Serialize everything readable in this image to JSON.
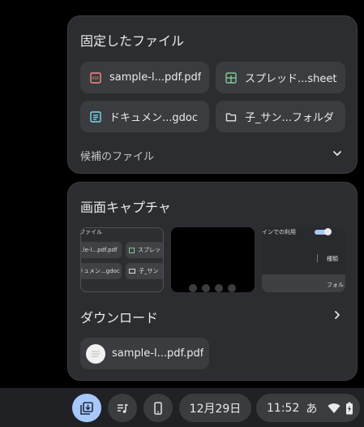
{
  "pinned": {
    "title": "固定したファイル",
    "files": [
      {
        "label": "sample-l...pdf.pdf",
        "icon": "pdf-file-icon",
        "badge": "PDF",
        "color": "#f28b82"
      },
      {
        "label": "スプレッド...sheet",
        "icon": "spreadsheet-icon",
        "color": "#81c995"
      },
      {
        "label": "ドキュメン...gdoc",
        "icon": "document-icon",
        "color": "#78d9ec"
      },
      {
        "label": "子_サン...フォルダ",
        "icon": "folder-icon",
        "color": "#e3e3e3"
      }
    ],
    "suggestions_label": "候補のファイル"
  },
  "holding": {
    "screenshots_title": "画面キャプチャ",
    "thumb1": {
      "header": "ファイル",
      "chip1": "...le-l...pdf.pdf",
      "chip2": "スプレッ",
      "chip3": "キュメン...gdoc",
      "chip4": "子_サン"
    },
    "thumb3": {
      "header": "インでの利用",
      "item": "種類",
      "footer": "フォル"
    },
    "downloads_title": "ダウンロード",
    "download_item": {
      "label": "sample-l...pdf.pdf"
    }
  },
  "shelf": {
    "date": "12月29日",
    "time": "11:52",
    "ime": "あ"
  },
  "colors": {
    "accent": "#a8c7fa",
    "panel": "#2c2d31",
    "chip": "#3b3c40"
  }
}
